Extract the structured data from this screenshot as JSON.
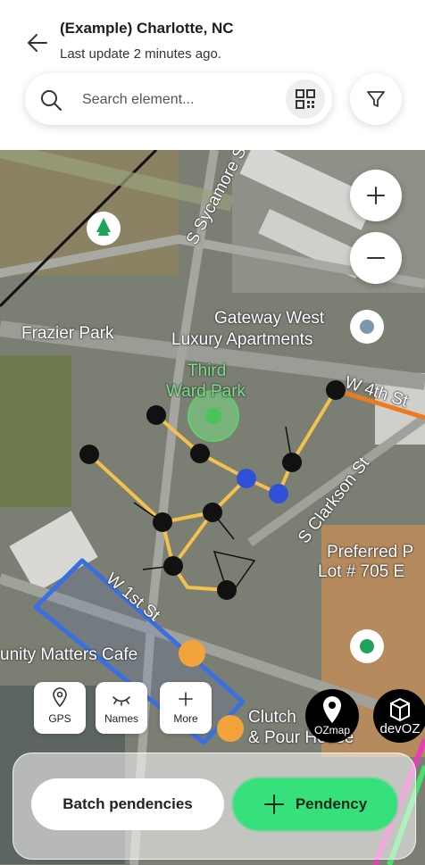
{
  "header": {
    "title": "(Example) Charlotte, NC",
    "subtitle": "Last update 2 minutes ago."
  },
  "search": {
    "placeholder": "Search element..."
  },
  "map": {
    "labels": {
      "sycamore": "S Sycamore St",
      "frazier": "Frazier Park",
      "gateway1": "Gateway West",
      "gateway2": "Luxury Apartments",
      "third1": "Third",
      "third2": "Ward Park",
      "w4th": "W 4th St",
      "clarkson": "S Clarkson St",
      "preferred1": "Preferred P",
      "preferred2": "Lot # 705 E",
      "w1st": "W 1st St",
      "community": "unity Matters Cafe",
      "clutch1": "Clutch",
      "clutch2": "& Pour House"
    }
  },
  "tools": {
    "gps": "GPS",
    "names": "Names",
    "more": "More"
  },
  "brands": {
    "ozmap": "OZmap",
    "devoz": "devOZ"
  },
  "actions": {
    "batch": "Batch pendencies",
    "pendency": "Pendency"
  },
  "colors": {
    "accent_green": "#36e07a",
    "route_yellow": "#f2c14e",
    "node_blue": "#3050d8",
    "area_blue": "#3a6fe0",
    "road_orange": "#f07a1e"
  }
}
